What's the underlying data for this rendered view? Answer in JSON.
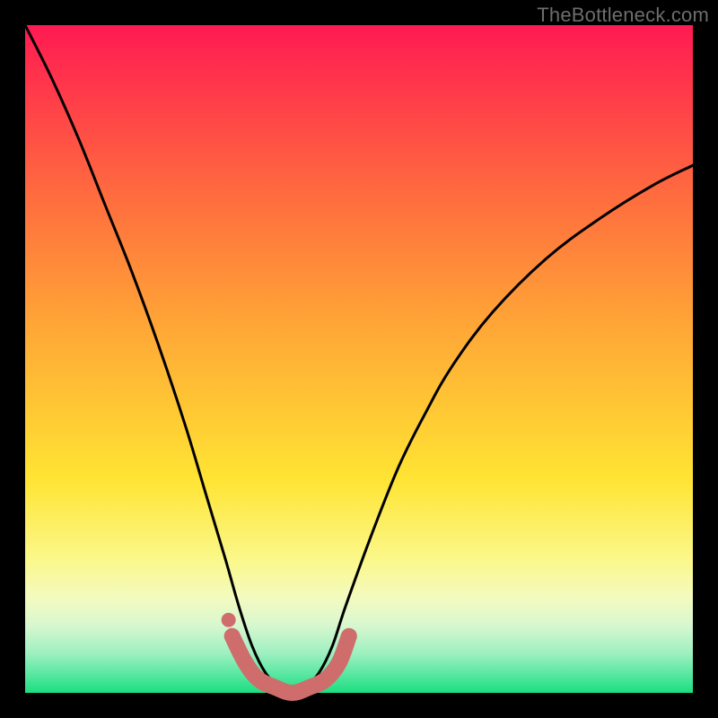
{
  "watermark": "TheBottleneck.com",
  "chart_data": {
    "type": "line",
    "title": "",
    "xlabel": "",
    "ylabel": "",
    "xlim": [
      0,
      1
    ],
    "ylim": [
      0,
      1
    ],
    "series": [
      {
        "name": "bottleneck-curve",
        "x": [
          0.0,
          0.04,
          0.08,
          0.12,
          0.16,
          0.2,
          0.24,
          0.27,
          0.3,
          0.32,
          0.34,
          0.36,
          0.38,
          0.4,
          0.42,
          0.44,
          0.46,
          0.48,
          0.52,
          0.56,
          0.6,
          0.64,
          0.7,
          0.78,
          0.86,
          0.94,
          1.0
        ],
        "y": [
          1.0,
          0.92,
          0.83,
          0.73,
          0.63,
          0.52,
          0.4,
          0.3,
          0.2,
          0.13,
          0.07,
          0.03,
          0.01,
          0.0,
          0.01,
          0.03,
          0.07,
          0.13,
          0.24,
          0.34,
          0.42,
          0.49,
          0.57,
          0.65,
          0.71,
          0.76,
          0.79
        ]
      }
    ],
    "highlight": {
      "name": "optimal-zone",
      "x": [
        0.31,
        0.33,
        0.35,
        0.375,
        0.4,
        0.425,
        0.45,
        0.47,
        0.485
      ],
      "y": [
        0.085,
        0.045,
        0.02,
        0.008,
        0.0,
        0.008,
        0.02,
        0.045,
        0.085
      ]
    },
    "background_gradient": {
      "stops": [
        {
          "pos": 0.0,
          "color": "#ff1a52"
        },
        {
          "pos": 0.5,
          "color": "#ffc936"
        },
        {
          "pos": 0.8,
          "color": "#fbf88a"
        },
        {
          "pos": 1.0,
          "color": "#1bde80"
        }
      ]
    }
  },
  "colors": {
    "curve": "#000000",
    "highlight": "#cf6d6d",
    "frame": "#000000",
    "watermark": "#6d6d6d"
  }
}
